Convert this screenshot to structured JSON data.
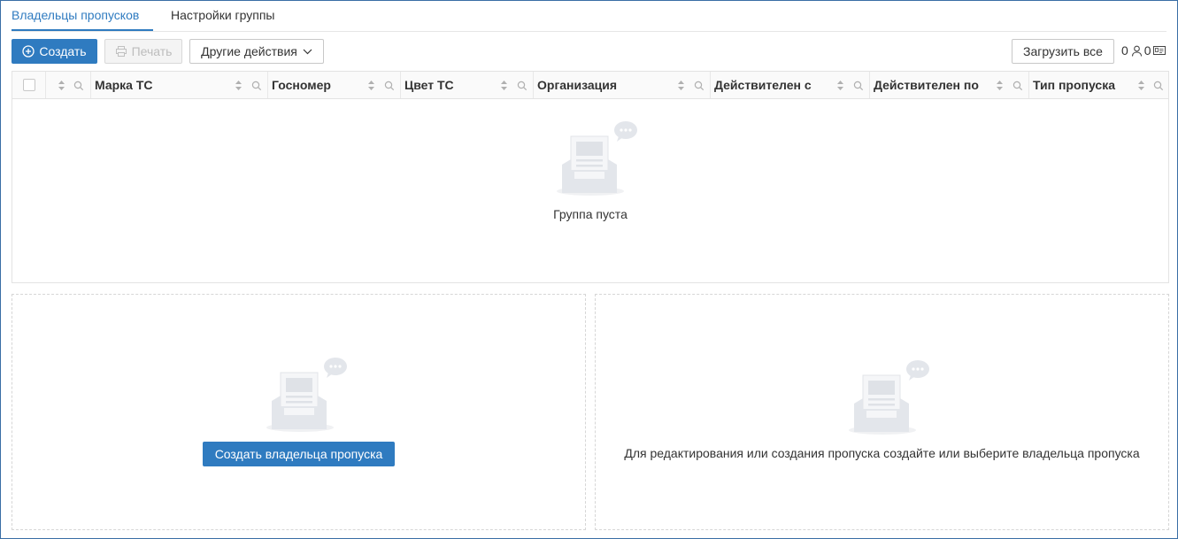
{
  "tabs": [
    {
      "label": "Владельцы пропусков",
      "active": true
    },
    {
      "label": "Настройки группы",
      "active": false
    }
  ],
  "toolbar": {
    "create_label": "Создать",
    "print_label": "Печать",
    "other_actions_label": "Другие действия",
    "load_all_label": "Загрузить все",
    "person_count": "0",
    "card_count": "0"
  },
  "table": {
    "columns": [
      "Марка ТС",
      "Госномер",
      "Цвет ТС",
      "Организация",
      "Действителен с",
      "Действителен по",
      "Тип пропуска"
    ],
    "empty_text": "Группа пуста"
  },
  "left_panel": {
    "button_label": "Создать владельца пропуска"
  },
  "right_panel": {
    "message": "Для редактирования или создания пропуска создайте или выберите владельца пропуска"
  },
  "colors": {
    "accent": "#2f7bc0",
    "border": "#e3e3e3",
    "illustration": "#e3e6eb"
  }
}
